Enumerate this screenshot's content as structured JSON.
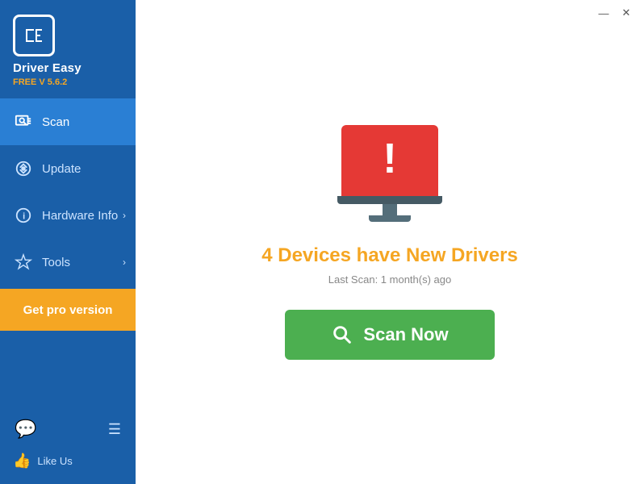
{
  "app": {
    "title": "Driver Easy",
    "version": "FREE V 5.6.2"
  },
  "titlebar": {
    "minimize_label": "—",
    "close_label": "✕"
  },
  "sidebar": {
    "items": [
      {
        "id": "scan",
        "label": "Scan",
        "active": true,
        "has_arrow": false
      },
      {
        "id": "update",
        "label": "Update",
        "active": false,
        "has_arrow": false
      },
      {
        "id": "hardware-info",
        "label": "Hardware Info",
        "active": false,
        "has_arrow": true
      },
      {
        "id": "tools",
        "label": "Tools",
        "active": false,
        "has_arrow": true
      }
    ],
    "get_pro_label": "Get pro version",
    "like_us_label": "Like Us"
  },
  "main": {
    "headline": "4 Devices have New Drivers",
    "last_scan": "Last Scan: 1 month(s) ago",
    "scan_button_label": "Scan Now"
  }
}
